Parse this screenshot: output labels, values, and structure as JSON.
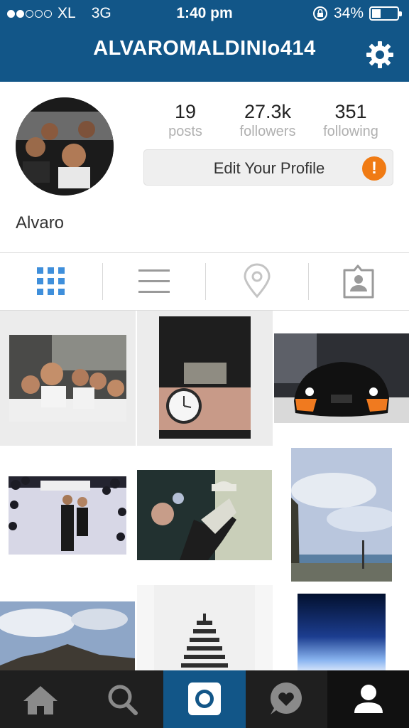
{
  "status_bar": {
    "carrier": "XL",
    "network": "3G",
    "time": "1:40 pm",
    "battery": "34%",
    "signal_bars_filled": 2,
    "signal_bars_total": 5
  },
  "header": {
    "username": "ALVAROMALDINIo414",
    "settings_icon": "gear-icon"
  },
  "profile": {
    "display_name": "Alvaro",
    "stats": [
      {
        "count": "19",
        "label": "posts"
      },
      {
        "count": "27.3k",
        "label": "followers"
      },
      {
        "count": "351",
        "label": "following"
      }
    ],
    "edit_button": "Edit Your Profile",
    "alert_symbol": "!"
  },
  "tabs": [
    {
      "name": "grid-view",
      "icon": "grid-icon",
      "active": true
    },
    {
      "name": "list-view",
      "icon": "list-icon",
      "active": false
    },
    {
      "name": "map-view",
      "icon": "location-pin-icon",
      "active": false
    },
    {
      "name": "tagged-photos",
      "icon": "person-tag-icon",
      "active": false
    }
  ],
  "photos": [
    {
      "caption": "group photo of students"
    },
    {
      "caption": "wristwatch"
    },
    {
      "caption": "black car with orange trim"
    },
    {
      "caption": "prom photo booth"
    },
    {
      "caption": "dancer with hat"
    },
    {
      "caption": "sky and coastline"
    },
    {
      "caption": "cliff and sky"
    },
    {
      "caption": "pagoda tower"
    },
    {
      "caption": "blue sky from above"
    }
  ],
  "nav": [
    {
      "icon": "home-icon",
      "active": false
    },
    {
      "icon": "search-icon",
      "active": false
    },
    {
      "icon": "camera-icon",
      "active": false
    },
    {
      "icon": "activity-heart-icon",
      "active": false
    },
    {
      "icon": "profile-icon",
      "active": true
    }
  ],
  "colors": {
    "brand": "#125688",
    "alert": "#f07b14",
    "active_tab": "#3f8fdb",
    "nav_bg": "#1f1f1f"
  }
}
